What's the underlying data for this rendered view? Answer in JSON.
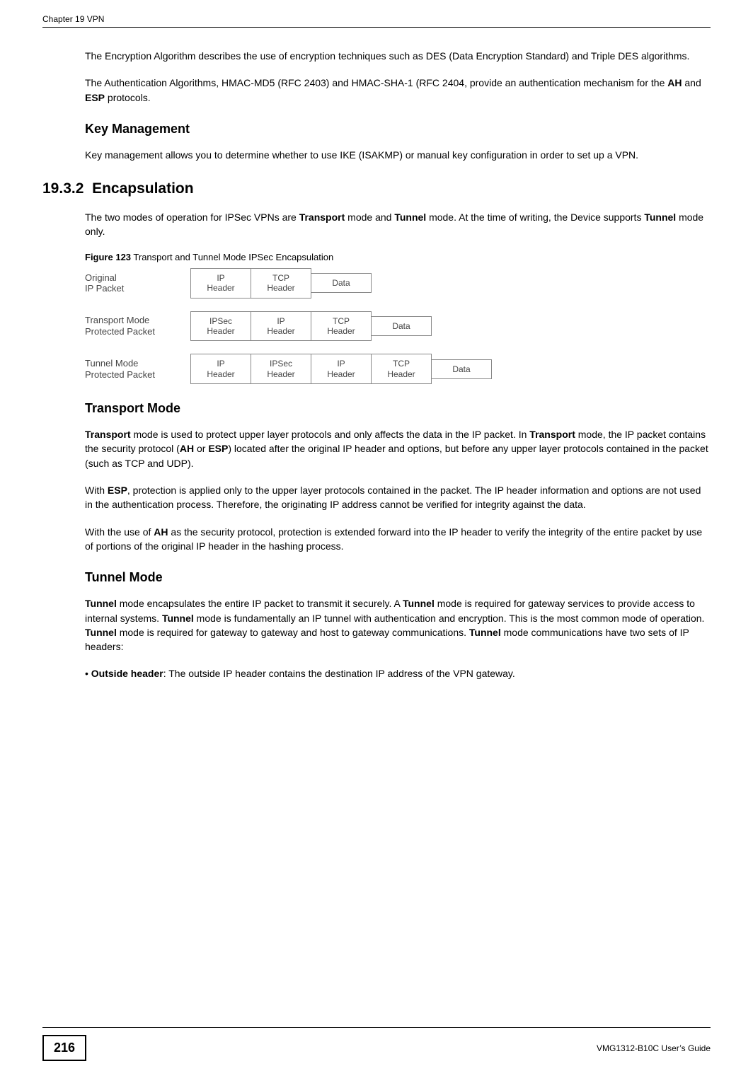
{
  "header": {
    "running": "Chapter 19 VPN"
  },
  "para": {
    "p1a": "The Encryption Algorithm describes the use of encryption techniques such as DES (Data Encryption Standard) and Triple DES algorithms.",
    "p1b_pre": "The Authentication Algorithms, HMAC-MD5 (RFC 2403) and HMAC-SHA-1 (RFC 2404, provide an authentication mechanism for the ",
    "p1b_b1": "AH",
    "p1b_mid": " and ",
    "p1b_b2": "ESP",
    "p1b_post": " protocols."
  },
  "keymgmt": {
    "heading": "Key Management",
    "p": "Key management allows you to determine whether to use IKE (ISAKMP) or manual key configuration in order to set up a VPN."
  },
  "encap": {
    "heading_num": "19.3.2",
    "heading_text": "Encapsulation",
    "p_pre": "The two modes of operation for IPSec VPNs are ",
    "p_b1": "Transport",
    "p_mid1": " mode and ",
    "p_b2": "Tunnel",
    "p_mid2": " mode. At the time of writing, the Device supports ",
    "p_b3": "Tunnel",
    "p_post": " mode only."
  },
  "figure": {
    "label": "Figure 123",
    "caption": "   Transport and Tunnel Mode IPSec Encapsulation",
    "rows": [
      {
        "label": "Original\nIP Packet",
        "cells": [
          "IP\nHeader",
          "TCP\nHeader",
          "Data"
        ]
      },
      {
        "label": "Transport Mode\nProtected Packet",
        "cells": [
          "IPSec\nHeader",
          "IP\nHeader",
          "TCP\nHeader",
          "Data"
        ]
      },
      {
        "label": "Tunnel Mode\nProtected Packet",
        "cells": [
          "IP\nHeader",
          "IPSec\nHeader",
          "IP\nHeader",
          "TCP\nHeader",
          "Data"
        ]
      }
    ]
  },
  "transport": {
    "heading": "Transport Mode",
    "p1_b1": "Transport",
    "p1_t1": " mode is used to protect upper layer protocols and only affects the data in the IP packet. In ",
    "p1_b2": "Transport",
    "p1_t2": " mode, the IP packet contains the security protocol (",
    "p1_b3": "AH",
    "p1_t3": " or ",
    "p1_b4": "ESP",
    "p1_t4": ") located after the original IP header and options, but before any upper layer protocols contained in the packet (such as TCP and UDP).",
    "p2_t1": "With ",
    "p2_b1": "ESP",
    "p2_t2": ", protection is applied only to the upper layer protocols contained in the packet. The IP header information and options are not used in the authentication process. Therefore, the originating IP address cannot be verified for integrity against the data.",
    "p3_t1": "With the use of ",
    "p3_b1": "AH",
    "p3_t2": " as the security protocol, protection is extended forward into the IP header to verify the integrity of the entire packet by use of portions of the original IP header in the hashing process."
  },
  "tunnel": {
    "heading": "Tunnel Mode",
    "p1_b1": "Tunnel",
    "p1_t1": " mode encapsulates the entire IP packet to transmit it securely. A ",
    "p1_b2": "Tunnel",
    "p1_t2": " mode is required for gateway services to provide access to internal systems. ",
    "p1_b3": "Tunnel",
    "p1_t3": " mode is fundamentally an IP tunnel with authentication and encryption. This is the most common mode of operation. ",
    "p1_b4": "Tunnel",
    "p1_t4": " mode is required for gateway to gateway and host to gateway communications. ",
    "p1_b5": "Tunnel",
    "p1_t5": " mode communications have two sets of IP headers:",
    "bullet_b": "Outside header",
    "bullet_t": ": The outside IP header contains the destination IP address of the VPN gateway."
  },
  "footer": {
    "page": "216",
    "guide": "VMG1312-B10C User’s Guide"
  }
}
